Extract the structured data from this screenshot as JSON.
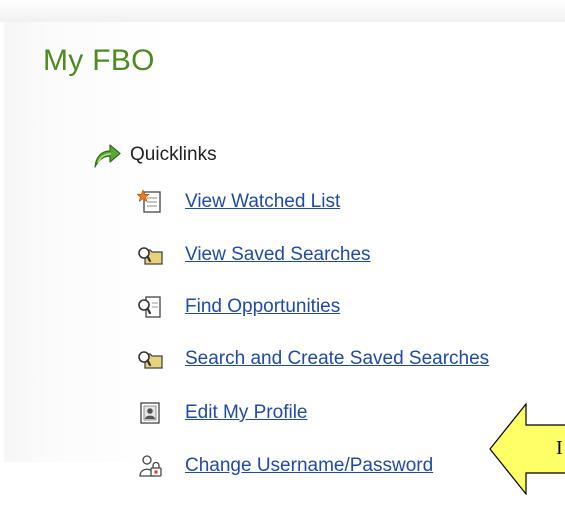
{
  "page": {
    "title": "My FBO"
  },
  "quicklinks": {
    "label": "Quicklinks",
    "icon": "green-curved-arrow-icon",
    "accent_color": "#4d8a1f",
    "link_color": "#1f4aa8",
    "items": [
      {
        "label": "View Watched List",
        "icon": "watched-list-star-icon"
      },
      {
        "label": "View Saved Searches",
        "icon": "saved-search-folder-icon"
      },
      {
        "label": "Find Opportunities",
        "icon": "find-document-magnifier-icon"
      },
      {
        "label": "Search and Create Saved Searches",
        "icon": "saved-search-folder-icon"
      },
      {
        "label": "Edit My Profile",
        "icon": "profile-card-icon"
      },
      {
        "label": "Change Username/Password",
        "icon": "lock-person-icon"
      }
    ]
  },
  "callout": {
    "text": "I",
    "fill_color": "#ffff66"
  }
}
